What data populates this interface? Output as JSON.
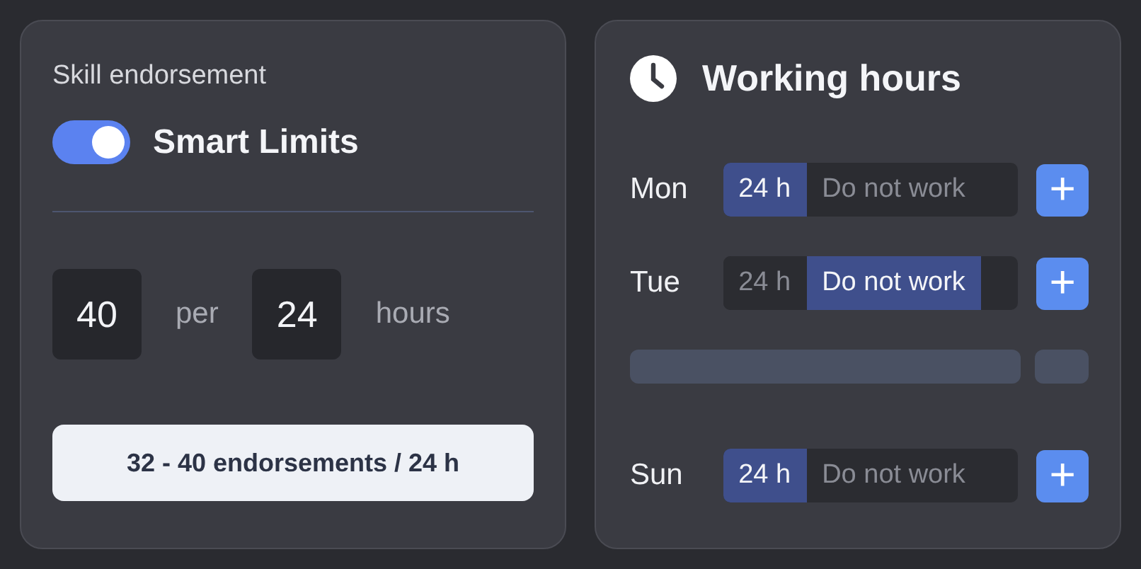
{
  "skill_card": {
    "title": "Skill endorsement",
    "toggle": {
      "label": "Smart Limits",
      "on": true
    },
    "limit": {
      "count": "40",
      "per_label": "per",
      "period": "24",
      "unit_label": "hours"
    },
    "summary_button": "32 - 40 endorsements / 24 h"
  },
  "hours_card": {
    "title": "Working hours",
    "rows": [
      {
        "kind": "day",
        "day": "Mon",
        "options": [
          {
            "label": "24 h",
            "selected": true
          },
          {
            "label": "Do not work",
            "selected": false
          }
        ],
        "add": "+"
      },
      {
        "kind": "day",
        "day": "Tue",
        "options": [
          {
            "label": "24 h",
            "selected": false
          },
          {
            "label": "Do not work",
            "selected": true
          }
        ],
        "add": "+"
      },
      {
        "kind": "placeholder"
      },
      {
        "kind": "day",
        "day": "Sun",
        "options": [
          {
            "label": "24 h",
            "selected": true
          },
          {
            "label": "Do not work",
            "selected": false
          }
        ],
        "add": "+"
      }
    ]
  }
}
